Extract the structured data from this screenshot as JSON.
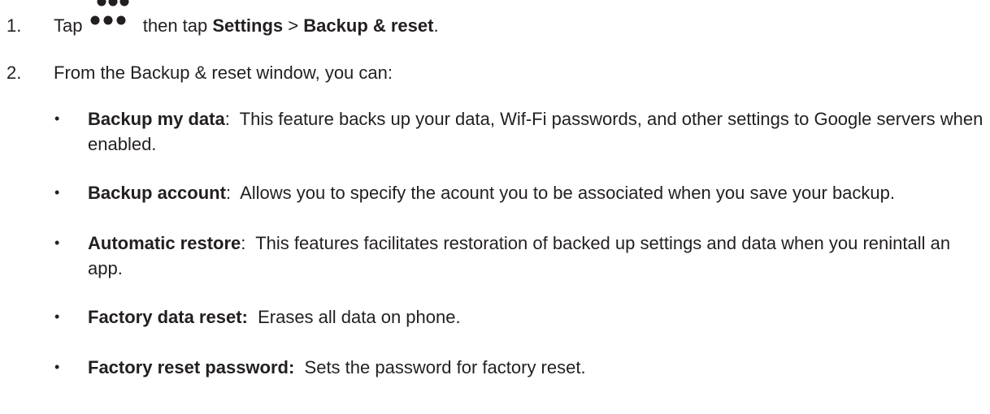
{
  "steps": [
    {
      "number": "1.",
      "prefix": "Tap",
      "icon": "three-dots-menu-icon",
      "middle": "then tap",
      "settings": "Settings",
      "separator": ">",
      "target": "Backup & reset",
      "end": "."
    },
    {
      "number": "2.",
      "text": "From the Backup & reset window, you can:"
    }
  ],
  "bullets": [
    {
      "mark": "•",
      "term": "Backup my data",
      "sep": ":",
      "desc": "  This feature backs up your data, Wif-Fi passwords, and other settings to Google servers when enabled."
    },
    {
      "mark": "•",
      "term": "Backup account",
      "sep": ":",
      "desc": "  Allows you to specify the acount you to be associated when you save your backup."
    },
    {
      "mark": "•",
      "term": "Automatic restore",
      "sep": ":",
      "desc": "  This features facilitates restoration of backed up settings and data when you renintall an app."
    },
    {
      "mark": "•",
      "term": "Factory data reset:",
      "sep": "",
      "desc": "  Erases all data on phone."
    },
    {
      "mark": "•",
      "term": "Factory reset password:",
      "sep": "",
      "desc": "  Sets the password for factory reset."
    }
  ]
}
